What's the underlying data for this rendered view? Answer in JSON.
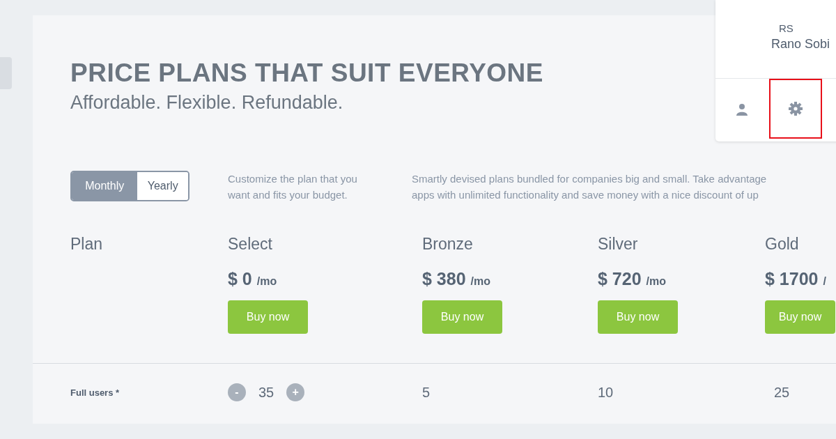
{
  "header": {
    "title": "PRICE PLANS THAT SUIT EVERYONE",
    "subtitle": "Affordable. Flexible. Refundable."
  },
  "billing_toggle": [
    {
      "label": "Monthly",
      "selected": true
    },
    {
      "label": "Yearly",
      "selected": false
    }
  ],
  "intro": "Customize the plan that you want and fits your budget.",
  "description": [
    "Smartly devised plans bundled for companies big and small. Take advantage",
    "apps with unlimited functionality and save money with a nice discount of up"
  ],
  "plan_label": "Plan",
  "plans": [
    {
      "name": "Select",
      "currency": "$",
      "price": "0",
      "unit": "/mo",
      "button": "Buy now"
    },
    {
      "name": "Bronze",
      "currency": "$",
      "price": "380",
      "unit": "/mo",
      "button": "Buy now"
    },
    {
      "name": "Silver",
      "currency": "$",
      "price": "720",
      "unit": "/mo",
      "button": "Buy now"
    },
    {
      "name": "Gold",
      "currency": "$",
      "price": "1700",
      "unit": "/",
      "button": "Buy now"
    }
  ],
  "full_users": {
    "label": "Full users *",
    "decrease": "-",
    "value": "35",
    "increase": "+",
    "plan_values": [
      "5",
      "10",
      "25"
    ]
  },
  "profile_menu": {
    "initials": "RS",
    "name": "Rano Sobi",
    "actions": [
      {
        "kind": "profile",
        "highlighted": false
      },
      {
        "kind": "settings",
        "highlighted": true
      }
    ]
  }
}
